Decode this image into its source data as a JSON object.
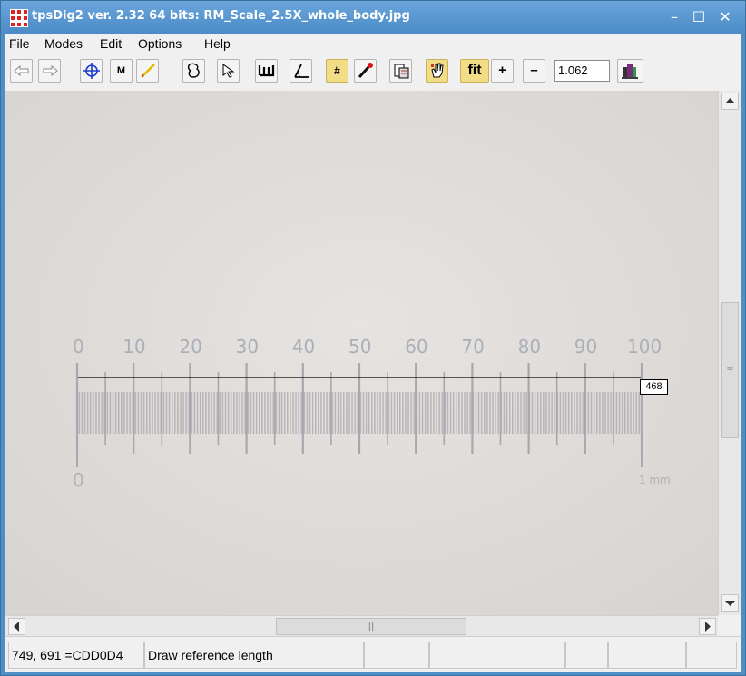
{
  "window": {
    "title": "tpsDig2 ver. 2.32 64 bits: RM_Scale_2.5X_whole_body.jpg",
    "minimize_glyph": "–",
    "maximize_glyph": "☐",
    "close_glyph": "✕",
    "title_color": "#4f8fc8"
  },
  "menu": {
    "items": [
      "File",
      "Modes",
      "Edit",
      "Options",
      "Help"
    ]
  },
  "toolbar": {
    "buttons": [
      {
        "name": "prev-image-button",
        "icon": "arrow-left-icon"
      },
      {
        "name": "next-image-button",
        "icon": "arrow-right-icon"
      },
      {
        "name": "digitize-landmarks-button",
        "icon": "crosshair-icon"
      },
      {
        "name": "measure-button",
        "label": "M"
      },
      {
        "name": "draw-line-button",
        "icon": "pencil-line-icon"
      },
      {
        "name": "draw-outline-button",
        "icon": "outline-icon"
      },
      {
        "name": "select-button",
        "icon": "pointer-icon"
      },
      {
        "name": "scale-button",
        "icon": "ruler-icon"
      },
      {
        "name": "angle-button",
        "icon": "angle-icon"
      },
      {
        "name": "grid-button",
        "label": "#"
      },
      {
        "name": "color-picker-button",
        "icon": "dropper-icon"
      },
      {
        "name": "copy-image-button",
        "icon": "clipboard-icon"
      },
      {
        "name": "pan-button",
        "icon": "hand-icon"
      },
      {
        "name": "fit-button",
        "label": "fit"
      },
      {
        "name": "zoom-in-button",
        "label": "+"
      },
      {
        "name": "zoom-out-button",
        "label": "–"
      },
      {
        "name": "exit-button",
        "icon": "exit-door-icon"
      }
    ],
    "zoom_value": "1.062"
  },
  "image": {
    "ruler_top_labels": [
      "0",
      "10",
      "20",
      "30",
      "40",
      "50",
      "60",
      "70",
      "80",
      "90",
      "100"
    ],
    "ruler_bottom_left": "0",
    "ruler_bottom_right": "1 mm",
    "reference_length": "468"
  },
  "status": {
    "coords": "749, 691 =CDD0D4",
    "mode": "Draw reference length",
    "panels": [
      "",
      "",
      "",
      "",
      ""
    ]
  },
  "colors": {
    "canvas_bg": "#e2dedd",
    "ruler_ink": "#9a9ea8",
    "fit_button": "#f3dc86"
  }
}
